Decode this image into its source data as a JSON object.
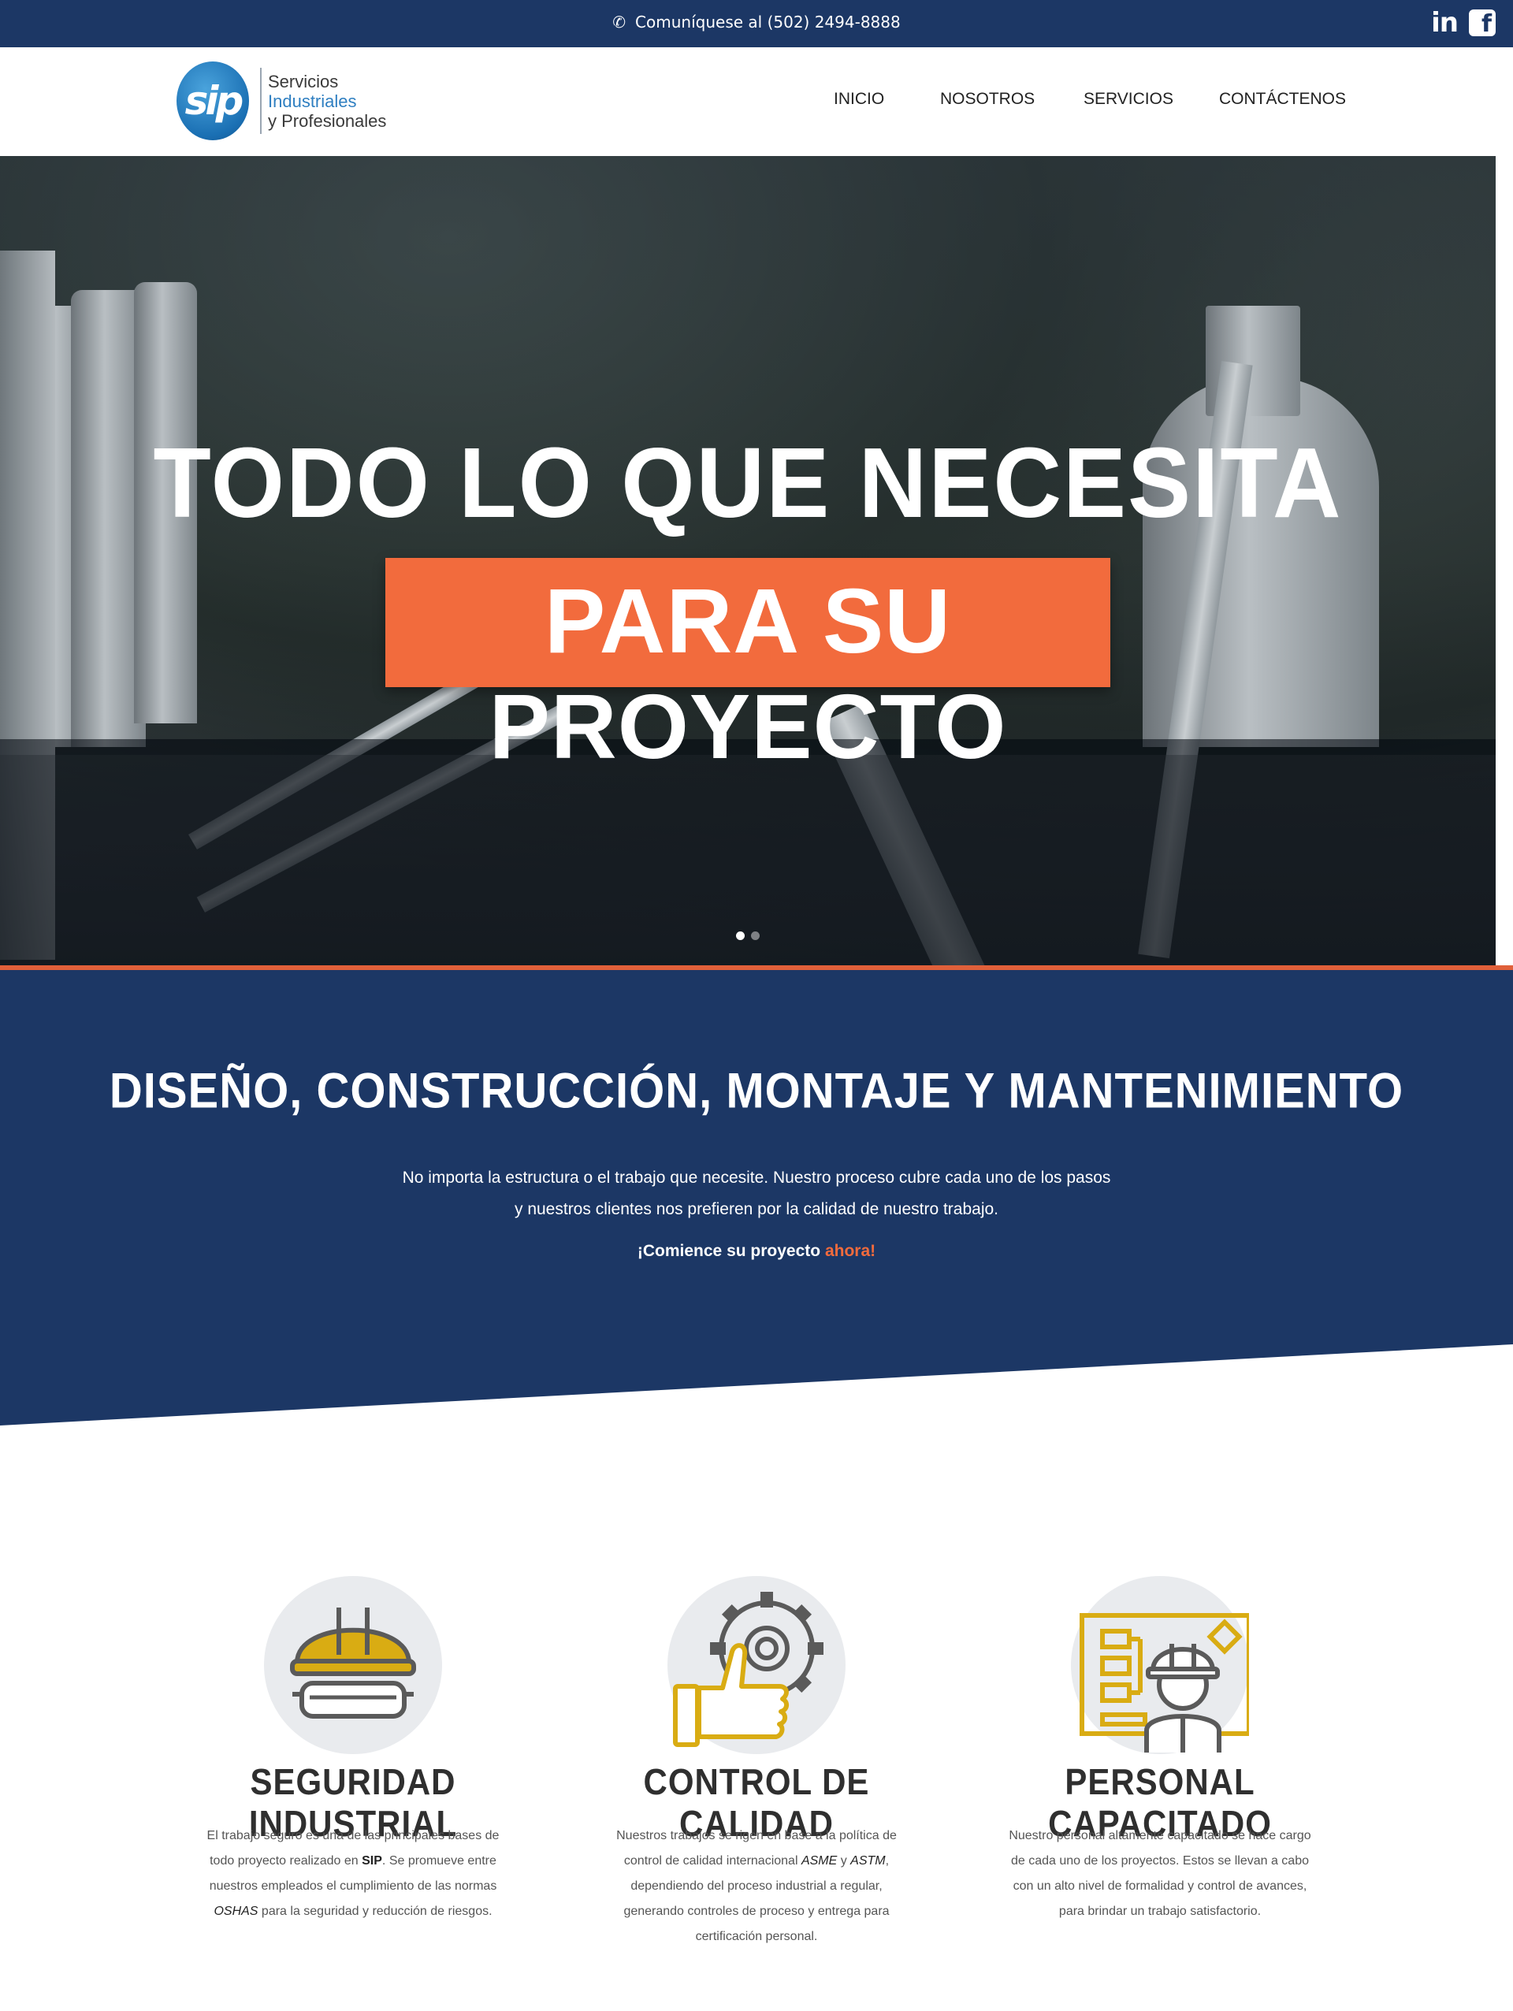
{
  "topbar": {
    "contact_text": "Comuníquese al (502) 2494-8888",
    "phone_icon": "phone-icon",
    "social": {
      "linkedin": "in",
      "facebook": "f"
    }
  },
  "logo": {
    "badge": "sip",
    "line1": "Servicios",
    "line2": "Industriales",
    "line3": "y Profesionales"
  },
  "nav": {
    "items": [
      "INICIO",
      "NOSOTROS",
      "SERVICIOS",
      "CONTÁCTENOS"
    ]
  },
  "hero": {
    "title_line1": "TODO LO QUE NECESITA",
    "title_line2": "PARA SU PROYECTO",
    "slides": 2,
    "active_slide": 1
  },
  "intro": {
    "heading": "DISEÑO, CONSTRUCCIÓN, MONTAJE Y MANTENIMIENTO",
    "paragraph": "No importa la estructura o el trabajo que necesite. Nuestro proceso cubre cada uno de los pasos y nuestros clientes nos prefieren por la calidad de nuestro trabajo.",
    "cta_text": "¡Comience su proyecto ",
    "cta_link": "ahora!"
  },
  "features": [
    {
      "icon": "hardhat-goggles-icon",
      "title": "SEGURIDAD INDUSTRIAL",
      "text_a": "El trabajo seguro es una de las principales bases de todo proyecto realizado en ",
      "text_b": "SIP",
      "text_c": ". Se promueve entre nuestros empleados el cumplimiento de las normas ",
      "text_d": "OSHAS",
      "text_e": " para la seguridad y reducción de riesgos."
    },
    {
      "icon": "gear-thumbs-up-icon",
      "title": "CONTROL DE CALIDAD",
      "text_a": "Nuestros trabajos se rigen en base a la política de control de calidad internacional ",
      "text_b": "ASME",
      "text_c": " y ",
      "text_d": "ASTM",
      "text_e": ", dependiendo del proceso industrial a regular, generando controles de proceso y entrega para certificación personal."
    },
    {
      "icon": "engineer-blueprint-icon",
      "title": "PERSONAL CAPACITADO",
      "text": "Nuestro personal altamente capacitado se hace cargo de cada uno de los proyectos. Estos se llevan a cabo con un alto nivel de formalidad y control de avances, para brindar un trabajo satisfactorio."
    }
  ],
  "colors": {
    "navy": "#1c3765",
    "accent": "#f26b3d",
    "icon_yellow": "#d9ac13",
    "icon_gray": "#5a5a5a"
  }
}
